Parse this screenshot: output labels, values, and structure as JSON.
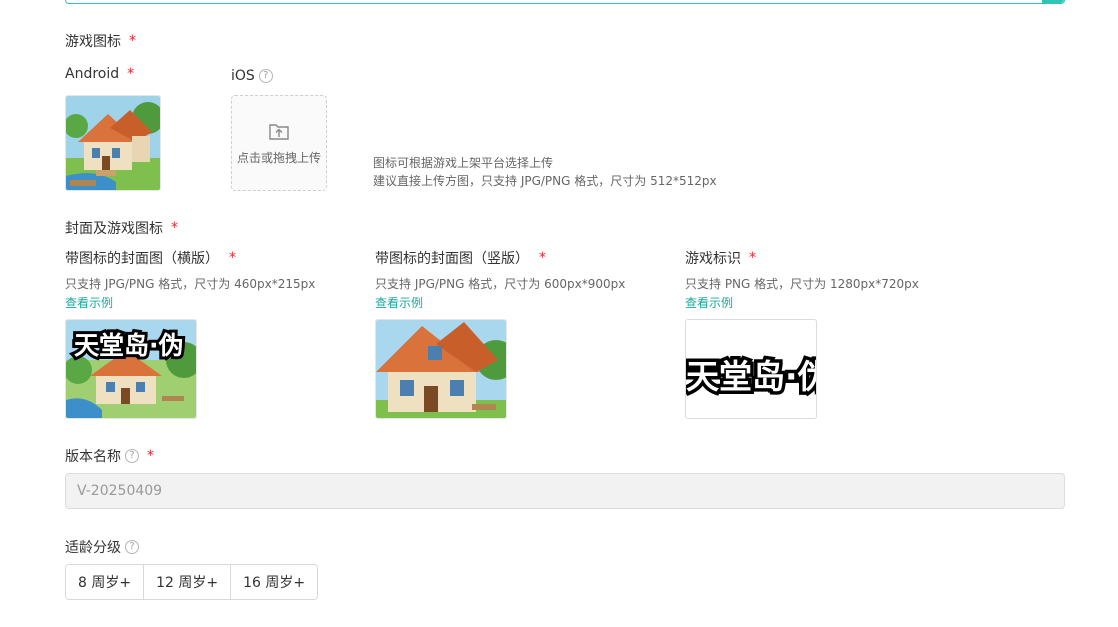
{
  "game_icon": {
    "section_label": "游戏图标",
    "android_label": "Android",
    "ios_label": "iOS",
    "upload_text": "点击或拖拽上传",
    "hint_line1": "图标可根据游戏上架平台选择上传",
    "hint_line2": "建议直接上传方图，只支持 JPG/PNG 格式，尺寸为 512*512px"
  },
  "cover": {
    "section_label": "封面及游戏图标",
    "landscape": {
      "label": "带图标的封面图（横版）",
      "hint": "只支持 JPG/PNG 格式，尺寸为 460px*215px",
      "example_link": "查看示例",
      "title_overlay": "天堂岛·伪"
    },
    "portrait": {
      "label": "带图标的封面图（竖版）",
      "hint": "只支持 JPG/PNG 格式，尺寸为 600px*900px",
      "example_link": "查看示例"
    },
    "logo": {
      "label": "游戏标识",
      "hint": "只支持 PNG 格式，尺寸为 1280px*720px",
      "example_link": "查看示例",
      "logo_text": "天堂岛·伪"
    }
  },
  "version": {
    "label": "版本名称",
    "value": "V-20250409"
  },
  "age_rating": {
    "label": "适龄分级",
    "options": [
      "8 周岁+",
      "12 周岁+",
      "16 周岁+"
    ]
  },
  "required_mark": "*",
  "help_mark": "?",
  "colors": {
    "accent": "#1aa89c",
    "required": "#f5222d",
    "border": "#d9d9d9"
  }
}
